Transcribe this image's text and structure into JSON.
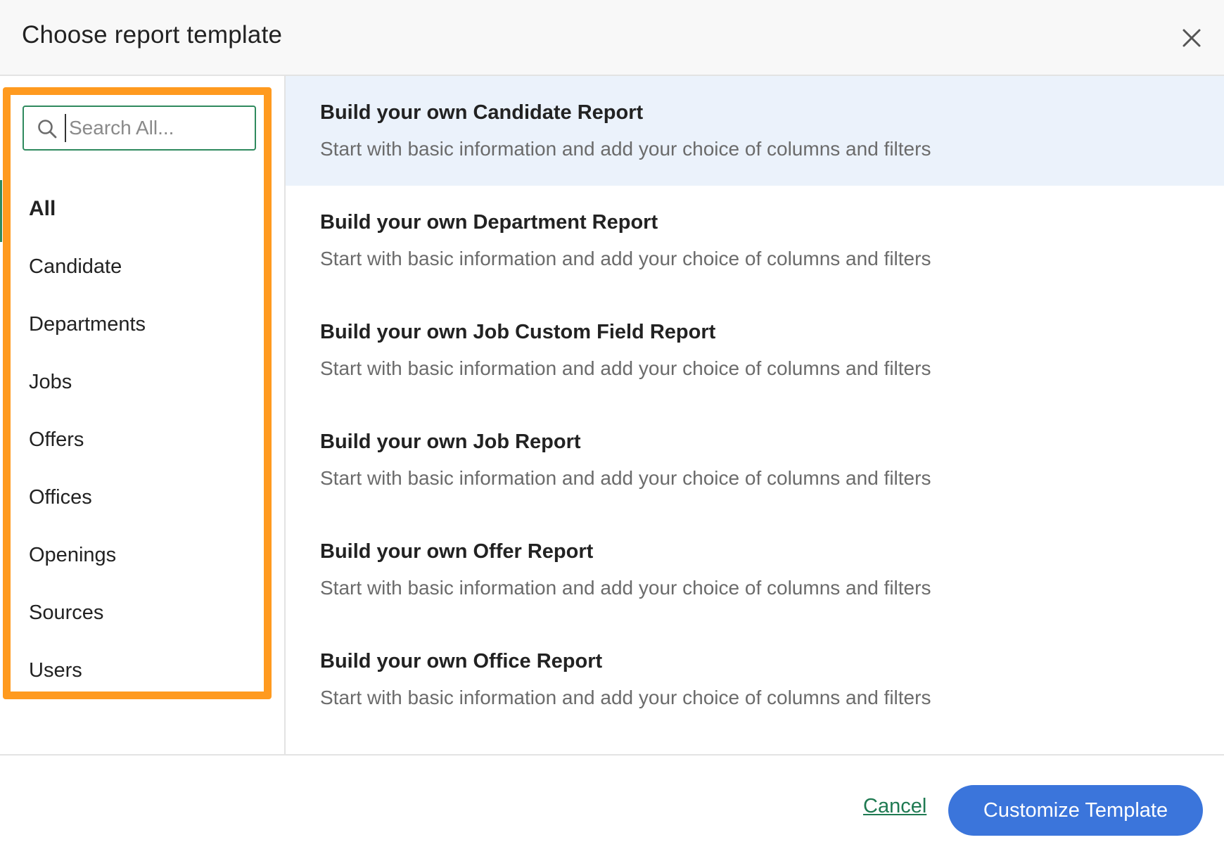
{
  "dialog": {
    "title": "Choose report template",
    "close_icon": "close-icon"
  },
  "search": {
    "placeholder": "Search All...",
    "value": "",
    "icon": "search-icon"
  },
  "sidebar": {
    "highlight_color": "#ff9a1f",
    "active_index": 0,
    "items": [
      {
        "label": "All"
      },
      {
        "label": "Candidate"
      },
      {
        "label": "Departments"
      },
      {
        "label": "Jobs"
      },
      {
        "label": "Offers"
      },
      {
        "label": "Offices"
      },
      {
        "label": "Openings"
      },
      {
        "label": "Sources"
      },
      {
        "label": "Users"
      }
    ]
  },
  "templates": {
    "selected_index": 0,
    "items": [
      {
        "title": "Build your own Candidate Report",
        "description": "Start with basic information and add your choice of columns and filters"
      },
      {
        "title": "Build your own Department Report",
        "description": "Start with basic information and add your choice of columns and filters"
      },
      {
        "title": "Build your own Job Custom Field Report",
        "description": "Start with basic information and add your choice of columns and filters"
      },
      {
        "title": "Build your own Job Report",
        "description": "Start with basic information and add your choice of columns and filters"
      },
      {
        "title": "Build your own Offer Report",
        "description": "Start with basic information and add your choice of columns and filters"
      },
      {
        "title": "Build your own Office Report",
        "description": "Start with basic information and add your choice of columns and filters"
      }
    ]
  },
  "footer": {
    "cancel_label": "Cancel",
    "primary_label": "Customize Template"
  },
  "colors": {
    "accent_green": "#2f8a5e",
    "primary_blue": "#3b75db",
    "selected_row_bg": "#ebf2fb"
  }
}
